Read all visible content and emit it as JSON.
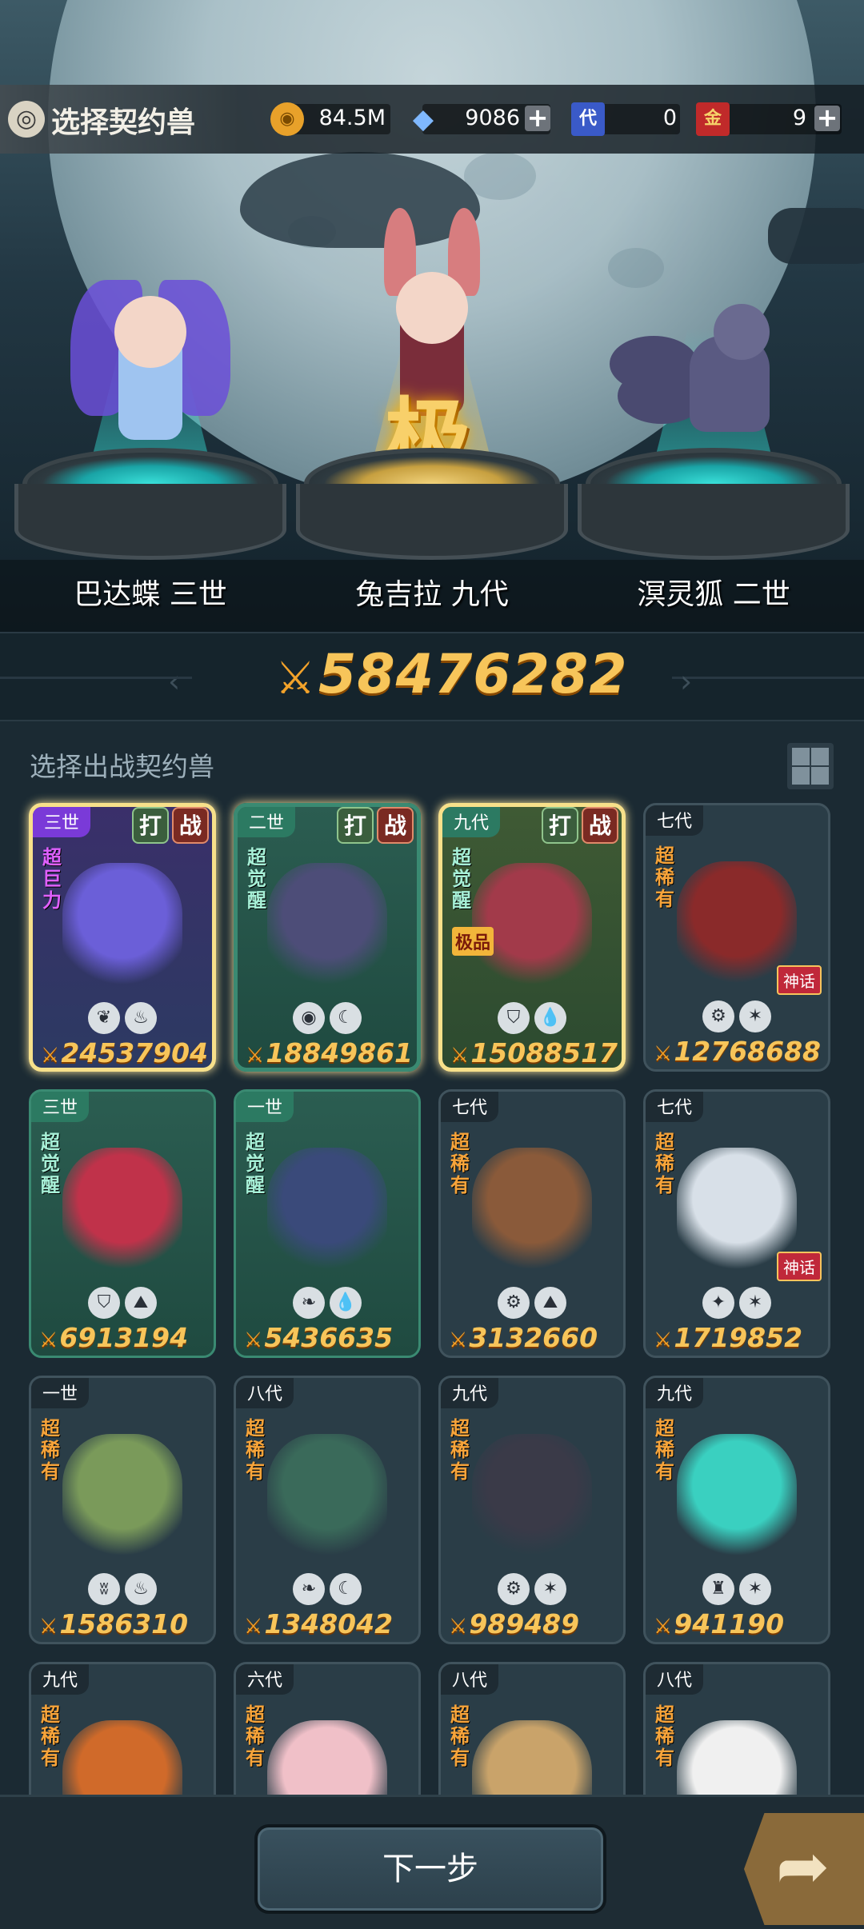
{
  "header": {
    "title": "选择契约兽",
    "resources": [
      {
        "name": "gold-coin",
        "value": "84.5M",
        "has_plus": false,
        "color": "#e8a12a"
      },
      {
        "name": "crystal",
        "value": "9086",
        "has_plus": true,
        "color": "#6aa8ff"
      },
      {
        "name": "dai-ticket",
        "value": "0",
        "has_plus": false,
        "color": "#3a5ac8"
      },
      {
        "name": "jin-ticket",
        "value": "9",
        "has_plus": true,
        "color": "#c02a2a"
      }
    ],
    "ticket_glyphs": {
      "dai": "代",
      "jin": "金"
    }
  },
  "heroes": [
    {
      "name": "巴达蝶 三世"
    },
    {
      "name": "兔吉拉 九代",
      "overlay": "极"
    },
    {
      "name": "溟灵狐 二世"
    }
  ],
  "total_power": "58476282",
  "section_title": "选择出战契约兽",
  "badge_text": {
    "da": "打",
    "zhan": "战"
  },
  "cards": [
    {
      "gen": "三世",
      "tag": "超巨力",
      "power": "24537904",
      "elements": [
        "aqua-leaf-icon",
        "fire-icon"
      ],
      "selected": true,
      "style": "purple",
      "badges": true
    },
    {
      "gen": "二世",
      "tag": "超觉醒",
      "power": "18849861",
      "elements": [
        "eye-icon",
        "moon-icon"
      ],
      "selected": true,
      "style": "green",
      "badges": true
    },
    {
      "gen": "九代",
      "tag": "超觉醒",
      "sub": "极品",
      "power": "15088517",
      "elements": [
        "shield-icon",
        "water-drop-icon"
      ],
      "selected": true,
      "style": "gold",
      "badges": true
    },
    {
      "gen": "七代",
      "tag": "超稀有",
      "myth": "神话",
      "power": "12768688",
      "elements": [
        "gear-icon",
        "star-icon"
      ]
    },
    {
      "gen": "三世",
      "tag": "超觉醒",
      "power": "6913194",
      "elements": [
        "shield-icon",
        "earth-icon"
      ],
      "style": "green"
    },
    {
      "gen": "一世",
      "tag": "超觉醒",
      "power": "5436635",
      "elements": [
        "leaf-icon",
        "water-drop-icon"
      ],
      "style": "green"
    },
    {
      "gen": "七代",
      "tag": "超稀有",
      "power": "3132660",
      "elements": [
        "gear-icon",
        "earth-icon"
      ]
    },
    {
      "gen": "七代",
      "tag": "超稀有",
      "myth": "神话",
      "power": "1719852",
      "elements": [
        "compass-icon",
        "star-icon"
      ]
    },
    {
      "gen": "一世",
      "tag": "超稀有",
      "power": "1586310",
      "elements": [
        "claw-icon",
        "fire-icon"
      ]
    },
    {
      "gen": "八代",
      "tag": "超稀有",
      "power": "1348042",
      "elements": [
        "leaf-icon",
        "moon-icon"
      ]
    },
    {
      "gen": "九代",
      "tag": "超稀有",
      "power": "989489",
      "elements": [
        "gear-icon",
        "star-icon"
      ]
    },
    {
      "gen": "九代",
      "tag": "超稀有",
      "power": "941190",
      "elements": [
        "tower-icon",
        "star-icon"
      ]
    },
    {
      "gen": "九代",
      "tag": "超稀有",
      "power": "",
      "elements": []
    },
    {
      "gen": "六代",
      "tag": "超稀有",
      "power": "",
      "elements": []
    },
    {
      "gen": "八代",
      "tag": "超稀有",
      "power": "",
      "elements": []
    },
    {
      "gen": "八代",
      "tag": "超稀有",
      "power": "",
      "elements": []
    }
  ],
  "next_button": "下一步"
}
